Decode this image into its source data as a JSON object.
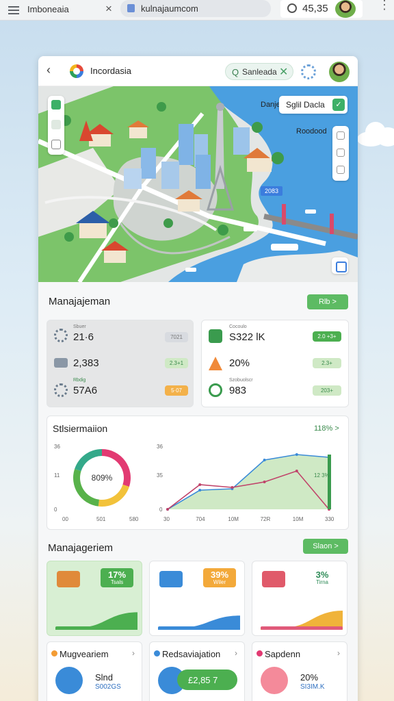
{
  "browser": {
    "tab_title": "Imboneaia",
    "close_glyph": "×",
    "url": "kulnajaumcom",
    "time": "45,35",
    "more_glyph": "⋮"
  },
  "app": {
    "back_glyph": "‹",
    "title": "Incordasia",
    "search_value": "Sanleada",
    "search_icon_glyph": "Q",
    "search_clear_glyph": "✕"
  },
  "map": {
    "label_box_text": "Sglil Dacla",
    "label_box_button_glyph": "✓",
    "corner_text": "Danje",
    "side_text": "Roodood",
    "sign_text": "2083"
  },
  "management": {
    "title": "Manajajeman",
    "button_label": "Rlb >",
    "left_panel": [
      {
        "small": "Sbuer",
        "value": "21·6",
        "tag": "7021",
        "tag_color": "#d8dbe0"
      },
      {
        "small": "",
        "value": "2,383",
        "tag": "2.3+1",
        "tag_color": "#cfe9c5"
      },
      {
        "small": "Rbdig",
        "value": "57A6",
        "tag": "5·07",
        "tag_color": "#f3b14a"
      }
    ],
    "right_panel": [
      {
        "small": "Cocoulo",
        "value": "S322 lK",
        "tag": "2.0 +3+",
        "tag_color": "#4caf50"
      },
      {
        "small": "",
        "value": "20%",
        "tag": "2.3+",
        "tag_color": "#cfe9c5"
      },
      {
        "small": "Szobuolscr",
        "value": "983",
        "tag": "203+",
        "tag_color": "#cfe9c5"
      }
    ]
  },
  "stats": {
    "title": "Stlsiermaiion",
    "right_value": "118% >",
    "donut": {
      "center_label": "809%",
      "y_ticks": [
        "36",
        "11",
        "0"
      ],
      "x_ticks": [
        "00",
        "501",
        "580"
      ]
    },
    "line": {
      "y_ticks": [
        "36",
        "35",
        "0"
      ],
      "x_ticks": [
        "30",
        "704",
        "10M",
        "72R",
        "10M",
        "330"
      ],
      "right_label": "12 3%"
    }
  },
  "chart_data": [
    {
      "type": "pie",
      "slices": [
        {
          "value": 30,
          "color": "#e23a72"
        },
        {
          "value": 22,
          "color": "#f2c23a"
        },
        {
          "value": 28,
          "color": "#58b24a"
        },
        {
          "value": 20,
          "color": "#34a98a"
        }
      ],
      "center_label": "809%"
    },
    {
      "type": "area",
      "x": [
        "30",
        "704",
        "10M",
        "72R",
        "10M",
        "330"
      ],
      "series": [
        {
          "values": [
            0,
            14,
            15,
            36,
            40,
            38
          ],
          "color": "#3a8bd8"
        },
        {
          "values": [
            0,
            18,
            16,
            20,
            28,
            0
          ],
          "color": "#c0436a"
        }
      ],
      "ylim": [
        0,
        45
      ]
    }
  ],
  "manage2": {
    "title": "Manajageriem",
    "button_label": "Slaon >",
    "cards": [
      {
        "pct": "17%",
        "sub": "Tsals",
        "badge_color": "#4caf50",
        "text_color": "#ffffff",
        "wave_color": "#4caf50",
        "progress": 0.72
      },
      {
        "pct": "39%",
        "sub": "Wiler",
        "badge_color": "#f3a93a",
        "text_color": "#ffffff",
        "wave_color": "#3a8bd8",
        "progress": 0.56
      },
      {
        "pct": "3%",
        "sub": "Tirna",
        "badge_color": "#ffffff",
        "text_color": "#2e8b57",
        "wave_color": "#f0b33a",
        "progress": 0.8
      }
    ]
  },
  "bottom": [
    {
      "title": "Mugveariem",
      "icon_color": "#f39c34",
      "value": "Slnd",
      "sub": "S002GS",
      "circle_color": "#3a8bd8"
    },
    {
      "title": "Redsaviajation",
      "icon_color": "#3a8bd8",
      "value": "£2,85 7",
      "sub": "",
      "circle_color": "#3a8bd8"
    },
    {
      "title": "Sapdenn",
      "icon_color": "#e23a72",
      "value": "20%",
      "sub": "SI3IM.K",
      "circle_color": "#f48a9a"
    }
  ]
}
